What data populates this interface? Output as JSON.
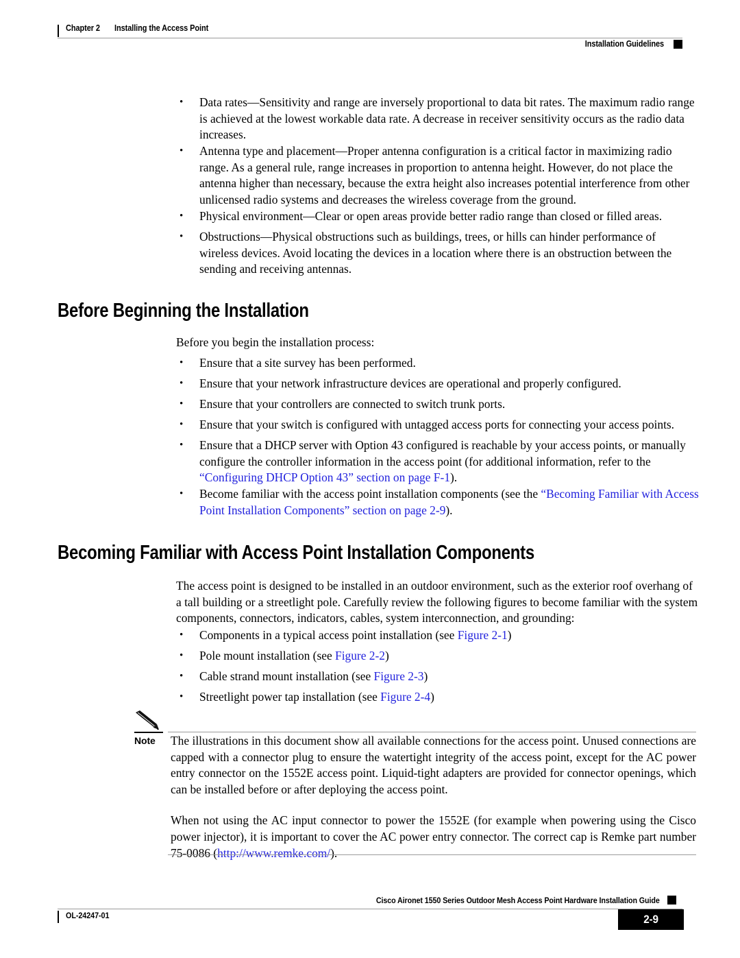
{
  "header": {
    "chapter_label": "Chapter 2",
    "chapter_title": "Installing the Access Point",
    "section_title": "Installation Guidelines"
  },
  "installation_guidelines": {
    "bullets": [
      {
        "term": "Data rates",
        "text": "Data rates—Sensitivity and range are inversely proportional to data bit rates. The maximum radio range is achieved at the lowest workable data rate. A decrease in receiver sensitivity occurs as the radio data increases."
      },
      {
        "term": "Antenna type and placement",
        "text": "Antenna type and placement—Proper antenna configuration is a critical factor in maximizing radio range. As a general rule, range increases in proportion to antenna height. However, do not place the antenna higher than necessary, because the extra height also increases potential interference from other unlicensed radio systems and decreases the wireless coverage from the ground."
      },
      {
        "term": "Physical environment",
        "text": "Physical environment—Clear or open areas provide better radio range than closed or filled areas."
      },
      {
        "term": "Obstructions",
        "text": "Obstructions—Physical obstructions such as buildings, trees, or hills can hinder performance of wireless devices. Avoid locating the devices in a location where there is an obstruction between the sending and receiving antennas."
      }
    ]
  },
  "before_beginning": {
    "heading": "Before Beginning the Installation",
    "intro": "Before you begin the installation process:",
    "bullets": [
      {
        "text": "Ensure that a site survey has been performed."
      },
      {
        "text": "Ensure that your network infrastructure devices are operational and properly configured."
      },
      {
        "text": "Ensure that your controllers are connected to switch trunk ports."
      },
      {
        "text": "Ensure that your switch is configured with untagged access ports for connecting your access points."
      }
    ],
    "dhcp_bullet": {
      "pre": "Ensure that a DHCP server with Option 43 configured is reachable by your access points, or manually configure the controller information in the access point (for additional information, refer to the ",
      "link": "“Configuring DHCP Option 43” section on page F-1",
      "post": ")."
    },
    "familiar_bullet": {
      "pre": "Become familiar with the access point installation components (see the ",
      "link": "“Becoming Familiar with Access Point Installation Components” section on page 2-9",
      "post": ")."
    }
  },
  "becoming_familiar": {
    "heading": "Becoming Familiar with Access Point Installation Components",
    "intro": "The access point is designed to be installed in an outdoor environment, such as the exterior roof overhang of a tall building or a streetlight pole. Carefully review the following figures to become familiar with the system components, connectors, indicators, cables, system interconnection, and grounding:",
    "bullets": [
      {
        "pre": "Components in a typical access point installation (see ",
        "link": "Figure 2-1",
        "post": ")"
      },
      {
        "pre": "Pole mount installation (see ",
        "link": "Figure 2-2",
        "post": ")"
      },
      {
        "pre": "Cable strand mount installation (see ",
        "link": "Figure 2-3",
        "post": ")"
      },
      {
        "pre": "Streetlight power tap installation (see ",
        "link": "Figure 2-4",
        "post": ")"
      }
    ]
  },
  "note": {
    "label": "Note",
    "icon": "pencil-icon",
    "paragraph1": "The illustrations in this document show all available connections for the access point. Unused connections are capped with a connector plug to ensure the watertight integrity of the access point, except for the AC power entry connector on the 1552E access point. Liquid-tight adapters are provided for connector openings, which can be installed before or after deploying the access point.",
    "paragraph2_pre": "When not using the AC input connector to power the 1552E (for example when powering using the Cisco power injector), it is important to cover the AC power entry connector. The correct cap is Remke part number 75-0086 (",
    "paragraph2_link": "http://www.remke.com/",
    "paragraph2_post": ")."
  },
  "footer": {
    "guide_title": "Cisco Aironet 1550 Series Outdoor Mesh Access Point Hardware Installation Guide",
    "doc_id": "OL-24247-01",
    "page_number": "2-9"
  },
  "colors": {
    "link": "#2222DD",
    "rule": "#9a9a9a",
    "text": "#000000"
  }
}
